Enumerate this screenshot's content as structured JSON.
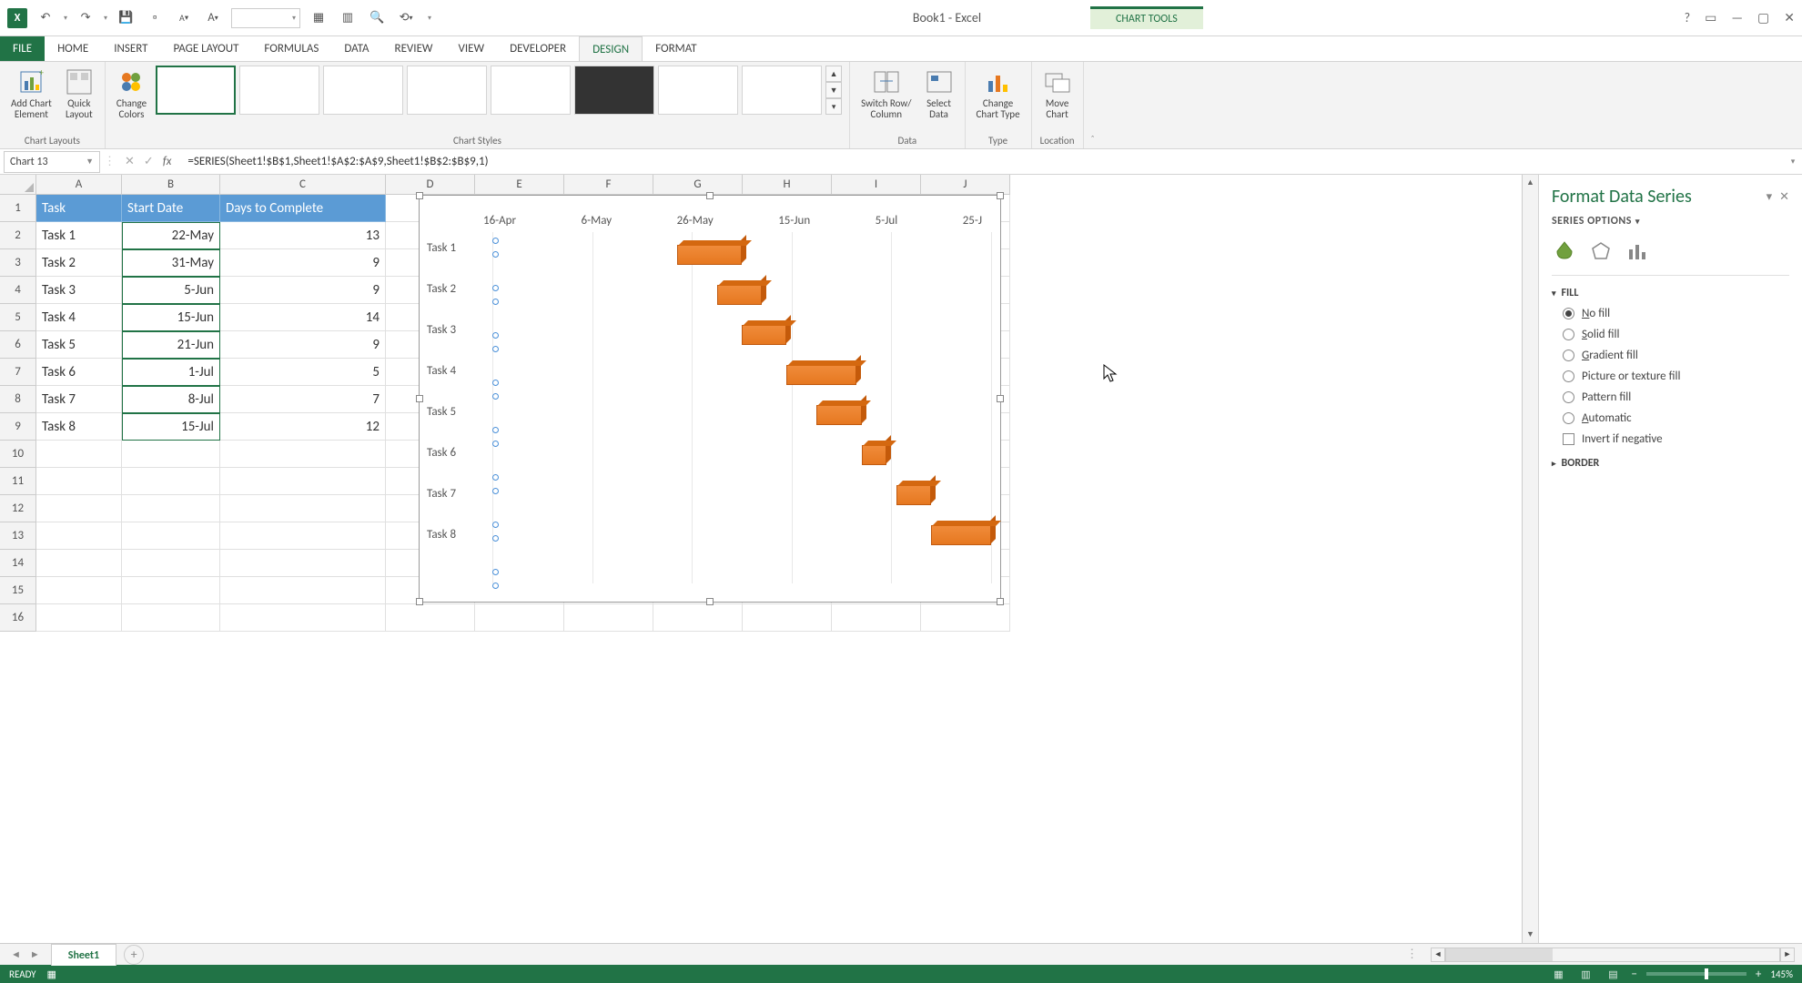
{
  "title": "Book1 - Excel",
  "chart_tools_label": "CHART TOOLS",
  "tabs": {
    "file": "FILE",
    "home": "HOME",
    "insert": "INSERT",
    "page_layout": "PAGE LAYOUT",
    "formulas": "FORMULAS",
    "data": "DATA",
    "review": "REVIEW",
    "view": "VIEW",
    "developer": "DEVELOPER",
    "design": "DESIGN",
    "format": "FORMAT"
  },
  "ribbon": {
    "add_chart_element": "Add Chart\nElement",
    "quick_layout": "Quick\nLayout",
    "change_colors": "Change\nColors",
    "chart_layouts": "Chart Layouts",
    "chart_styles": "Chart Styles",
    "switch_row_col": "Switch Row/\nColumn",
    "select_data": "Select\nData",
    "data": "Data",
    "change_chart_type": "Change\nChart Type",
    "type": "Type",
    "move_chart": "Move\nChart",
    "location": "Location"
  },
  "name_box": "Chart 13",
  "formula": "=SERIES(Sheet1!$B$1,Sheet1!$A$2:$A$9,Sheet1!$B$2:$B$9,1)",
  "columns": [
    "A",
    "B",
    "C",
    "D",
    "E",
    "F",
    "G",
    "H",
    "I",
    "J"
  ],
  "row_numbers": [
    "1",
    "2",
    "3",
    "4",
    "5",
    "6",
    "7",
    "8",
    "9",
    "10",
    "11",
    "12",
    "13",
    "14",
    "15",
    "16"
  ],
  "headers": {
    "task": "Task",
    "start": "Start Date",
    "days": "Days to Complete"
  },
  "rows": [
    {
      "task": "Task 1",
      "start": "22-May",
      "days": "13"
    },
    {
      "task": "Task 2",
      "start": "31-May",
      "days": "9"
    },
    {
      "task": "Task 3",
      "start": "5-Jun",
      "days": "9"
    },
    {
      "task": "Task 4",
      "start": "15-Jun",
      "days": "14"
    },
    {
      "task": "Task 5",
      "start": "21-Jun",
      "days": "9"
    },
    {
      "task": "Task 6",
      "start": "1-Jul",
      "days": "5"
    },
    {
      "task": "Task 7",
      "start": "8-Jul",
      "days": "7"
    },
    {
      "task": "Task 8",
      "start": "15-Jul",
      "days": "12"
    }
  ],
  "chart_data": {
    "type": "bar",
    "categories": [
      "Task 1",
      "Task 2",
      "Task 3",
      "Task 4",
      "Task 5",
      "Task 6",
      "Task 7",
      "Task 8"
    ],
    "x_ticks": [
      "16-Apr",
      "6-May",
      "26-May",
      "15-Jun",
      "5-Jul",
      "25-J"
    ],
    "series": [
      {
        "name": "Start Date",
        "values_display": [
          "22-May",
          "31-May",
          "5-Jun",
          "15-Jun",
          "21-Jun",
          "1-Jul",
          "8-Jul",
          "15-Jul"
        ],
        "bar_left_pct": [
          37,
          45,
          50,
          59,
          65,
          74,
          81,
          88
        ]
      },
      {
        "name": "Days to Complete",
        "values": [
          13,
          9,
          9,
          14,
          9,
          5,
          7,
          12
        ],
        "bar_width_pct": [
          13,
          9,
          9,
          14,
          9,
          5,
          7,
          12
        ]
      }
    ],
    "gridlines_x_pct": [
      0,
      20,
      40,
      60,
      80,
      100
    ]
  },
  "pane": {
    "title": "Format Data Series",
    "series_options": "SERIES OPTIONS",
    "fill": "FILL",
    "opts": {
      "no_fill_u": "N",
      "no_fill": "o fill",
      "solid_u": "S",
      "solid": "olid fill",
      "grad_u": "G",
      "grad": "radient fill",
      "pic": "Picture or texture fill",
      "pat": "Pattern fill",
      "auto_u": "A",
      "auto": "utomatic",
      "invert_u": "I",
      "invert": "nvert if negative"
    },
    "border": "BORDER"
  },
  "sheet_tab": "Sheet1",
  "status": {
    "ready": "READY",
    "zoom": "145%"
  }
}
